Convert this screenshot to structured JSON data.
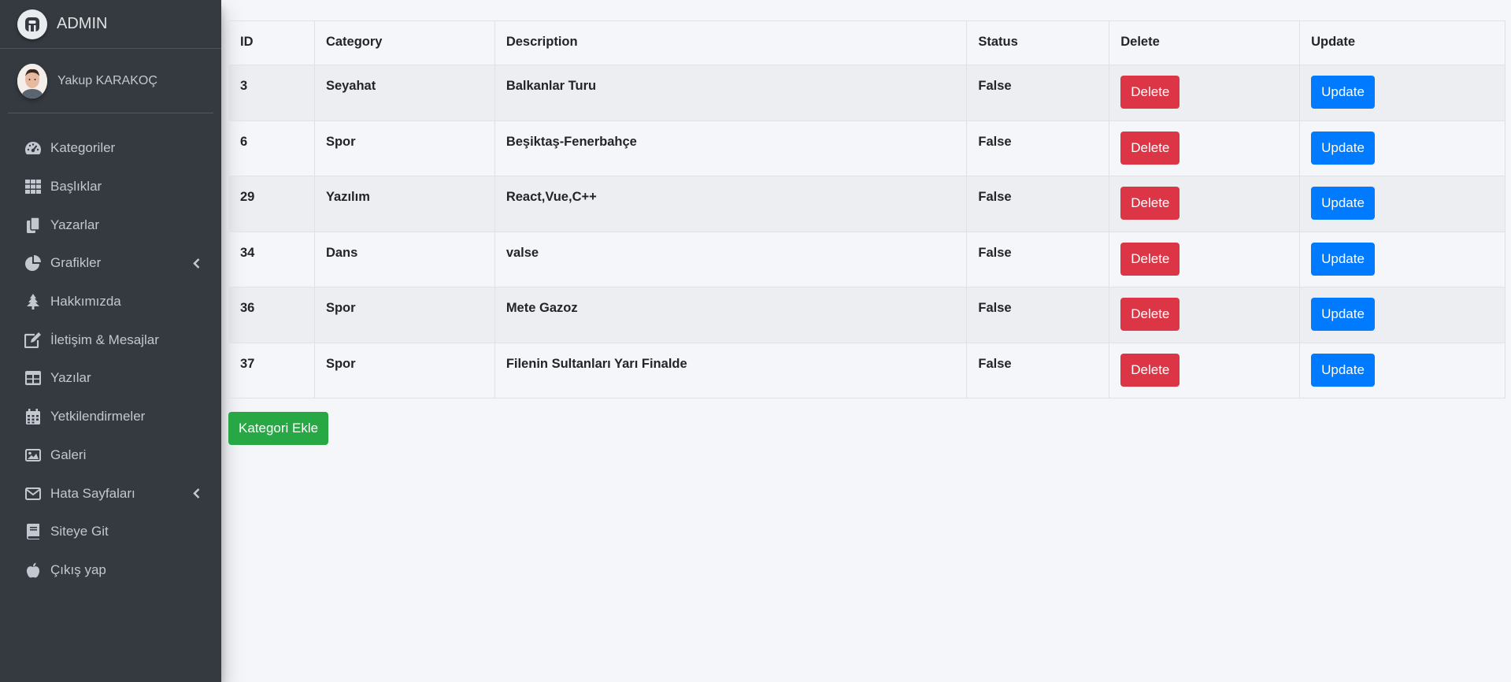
{
  "brand": {
    "title": "ADMIN",
    "logo_letter": "A"
  },
  "user": {
    "name": "Yakup KARAKOÇ"
  },
  "nav": [
    {
      "label": "Kategoriler",
      "icon": "tachometer-icon",
      "has_arrow": false
    },
    {
      "label": "Başlıklar",
      "icon": "grid-icon",
      "has_arrow": false
    },
    {
      "label": "Yazarlar",
      "icon": "copy-icon",
      "has_arrow": false
    },
    {
      "label": "Grafikler",
      "icon": "pie-chart-icon",
      "has_arrow": true
    },
    {
      "label": "Hakkımızda",
      "icon": "tree-icon",
      "has_arrow": false
    },
    {
      "label": "İletişim & Mesajlar",
      "icon": "edit-icon",
      "has_arrow": false
    },
    {
      "label": "Yazılar",
      "icon": "table-icon",
      "has_arrow": false
    },
    {
      "label": "Yetkilendirmeler",
      "icon": "calendar-icon",
      "has_arrow": false
    },
    {
      "label": "Galeri",
      "icon": "image-icon",
      "has_arrow": false
    },
    {
      "label": "Hata Sayfaları",
      "icon": "envelope-icon",
      "has_arrow": true
    },
    {
      "label": "Siteye Git",
      "icon": "book-icon",
      "has_arrow": false
    },
    {
      "label": "Çıkış yap",
      "icon": "apple-icon",
      "has_arrow": false
    }
  ],
  "table": {
    "headers": [
      "ID",
      "Category",
      "Description",
      "Status",
      "Delete",
      "Update"
    ],
    "rows": [
      {
        "id": "3",
        "category": "Seyahat",
        "description": "Balkanlar Turu",
        "status": "False"
      },
      {
        "id": "6",
        "category": "Spor",
        "description": "Beşiktaş-Fenerbahçe",
        "status": "False"
      },
      {
        "id": "29",
        "category": "Yazılım",
        "description": "React,Vue,C++",
        "status": "False"
      },
      {
        "id": "34",
        "category": "Dans",
        "description": "valse",
        "status": "False"
      },
      {
        "id": "36",
        "category": "Spor",
        "description": "Mete Gazoz",
        "status": "False"
      },
      {
        "id": "37",
        "category": "Spor",
        "description": "Filenin Sultanları Yarı Finalde",
        "status": "False"
      }
    ],
    "delete_label": "Delete",
    "update_label": "Update"
  },
  "add_button_label": "Kategori Ekle",
  "colors": {
    "sidebar_bg": "#343a40",
    "danger": "#dc3545",
    "primary": "#007bff",
    "success": "#28a745",
    "page_bg": "#f4f6f9"
  }
}
